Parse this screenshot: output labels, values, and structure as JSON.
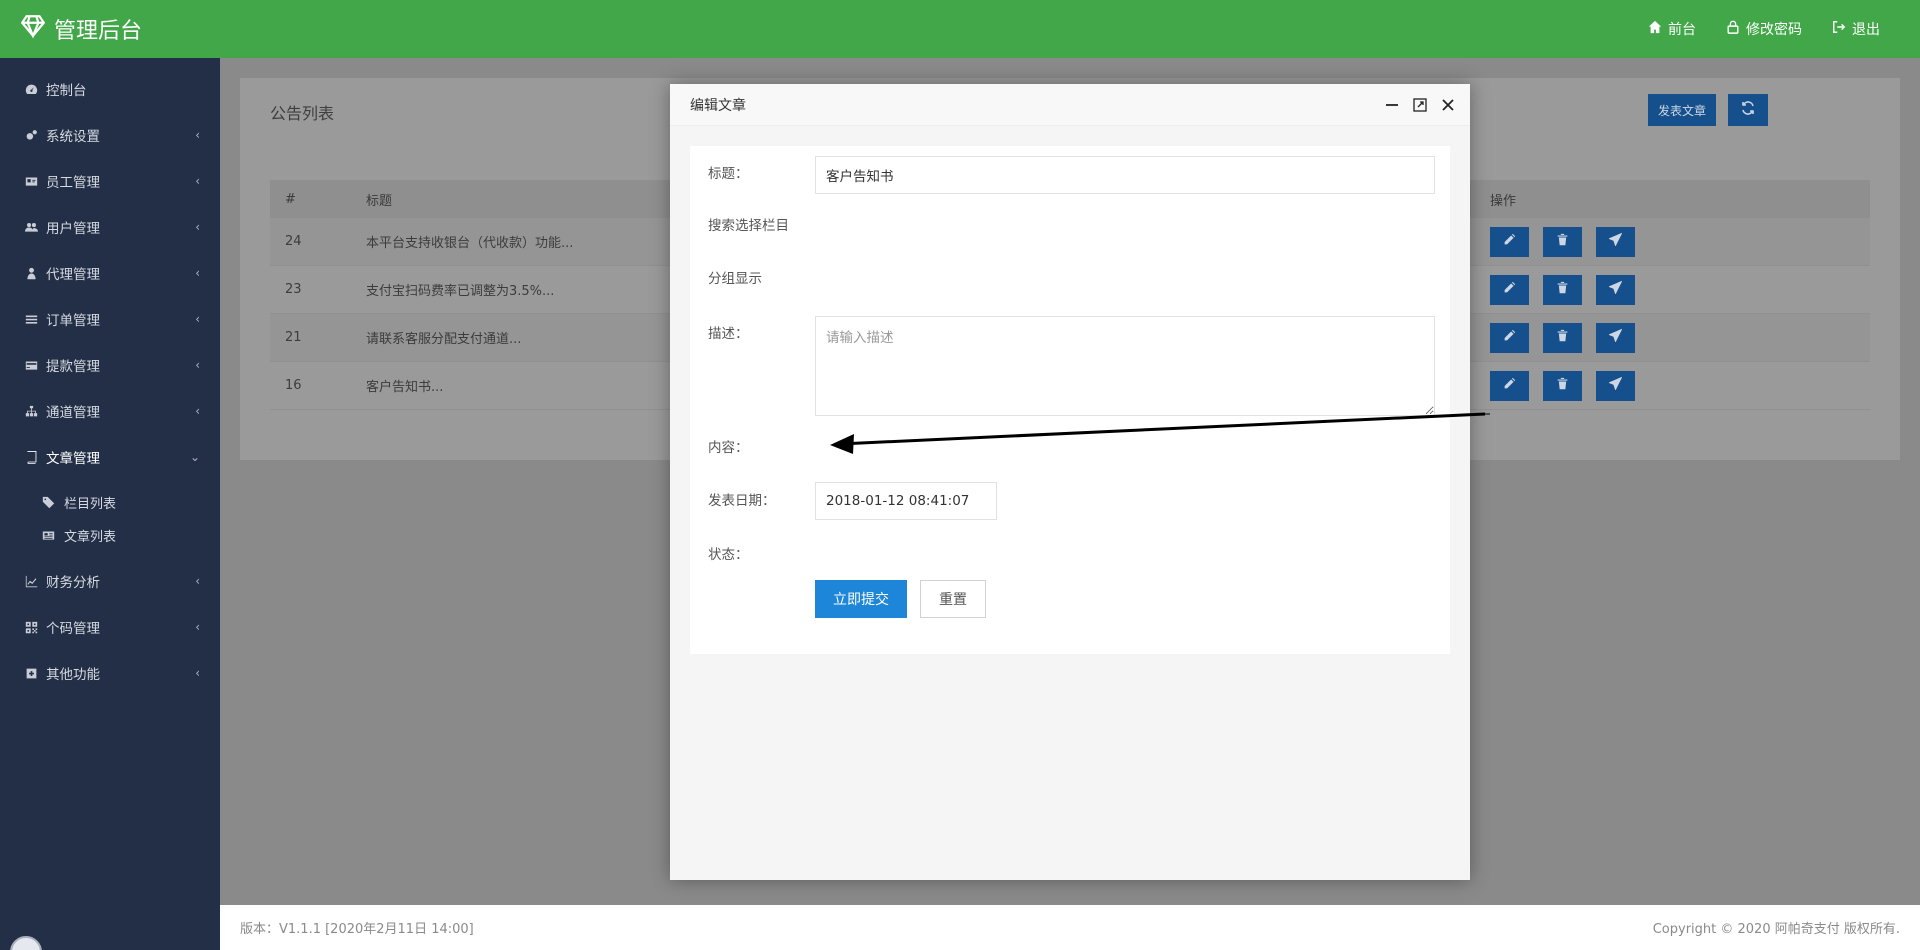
{
  "header": {
    "app_title": "管理后台",
    "nav": [
      {
        "label": "前台",
        "icon": "home-icon"
      },
      {
        "label": "修改密码",
        "icon": "lock-icon"
      },
      {
        "label": "退出",
        "icon": "logout-icon"
      }
    ]
  },
  "sidebar": {
    "items": [
      {
        "label": "控制台",
        "icon": "dashboard-icon"
      },
      {
        "label": "系统设置",
        "icon": "cogs-icon"
      },
      {
        "label": "员工管理",
        "icon": "id-card-icon"
      },
      {
        "label": "用户管理",
        "icon": "users-icon"
      },
      {
        "label": "代理管理",
        "icon": "agent-icon"
      },
      {
        "label": "订单管理",
        "icon": "list-icon"
      },
      {
        "label": "提款管理",
        "icon": "credit-card-icon"
      },
      {
        "label": "通道管理",
        "icon": "sitemap-icon"
      },
      {
        "label": "文章管理",
        "icon": "book-icon"
      },
      {
        "label": "财务分析",
        "icon": "line-chart-icon"
      },
      {
        "label": "个码管理",
        "icon": "qrcode-icon"
      },
      {
        "label": "其他功能",
        "icon": "plus-square-icon"
      }
    ],
    "sub_items": [
      {
        "label": "栏目列表",
        "icon": "tags-icon"
      },
      {
        "label": "文章列表",
        "icon": "newspaper-icon"
      }
    ]
  },
  "main": {
    "card_title": "公告列表",
    "publish_label": "发表文章",
    "table": {
      "columns": [
        "#",
        "标题",
        "操作"
      ],
      "rows": [
        {
          "id": "24",
          "title": "本平台支持收银台（代收款）功能..."
        },
        {
          "id": "23",
          "title": "支付宝扫码费率已调整为3.5%..."
        },
        {
          "id": "21",
          "title": "请联系客服分配支付通道..."
        },
        {
          "id": "16",
          "title": "客户告知书..."
        }
      ]
    }
  },
  "modal": {
    "title": "编辑文章",
    "fields": {
      "title_label": "标题：",
      "title_value": "客户告知书",
      "category_label": "搜索选择栏目",
      "group_label": "分组显示",
      "desc_label": "描述：",
      "desc_placeholder": "请输入描述",
      "content_label": "内容：",
      "date_label": "发表日期：",
      "date_value": "2018-01-12 08:41:07",
      "status_label": "状态："
    },
    "submit_label": "立即提交",
    "reset_label": "重置"
  },
  "footer": {
    "version": "版本：V1.1.1 [2020年2月11日 14:00]",
    "copyright": "Copyright © 2020 阿帕奇支付 版权所有."
  },
  "colors": {
    "header_bg": "#42a748",
    "sidebar_bg": "#232f46",
    "primary_button": "#1e86d9",
    "dark_button": "#15508d"
  }
}
